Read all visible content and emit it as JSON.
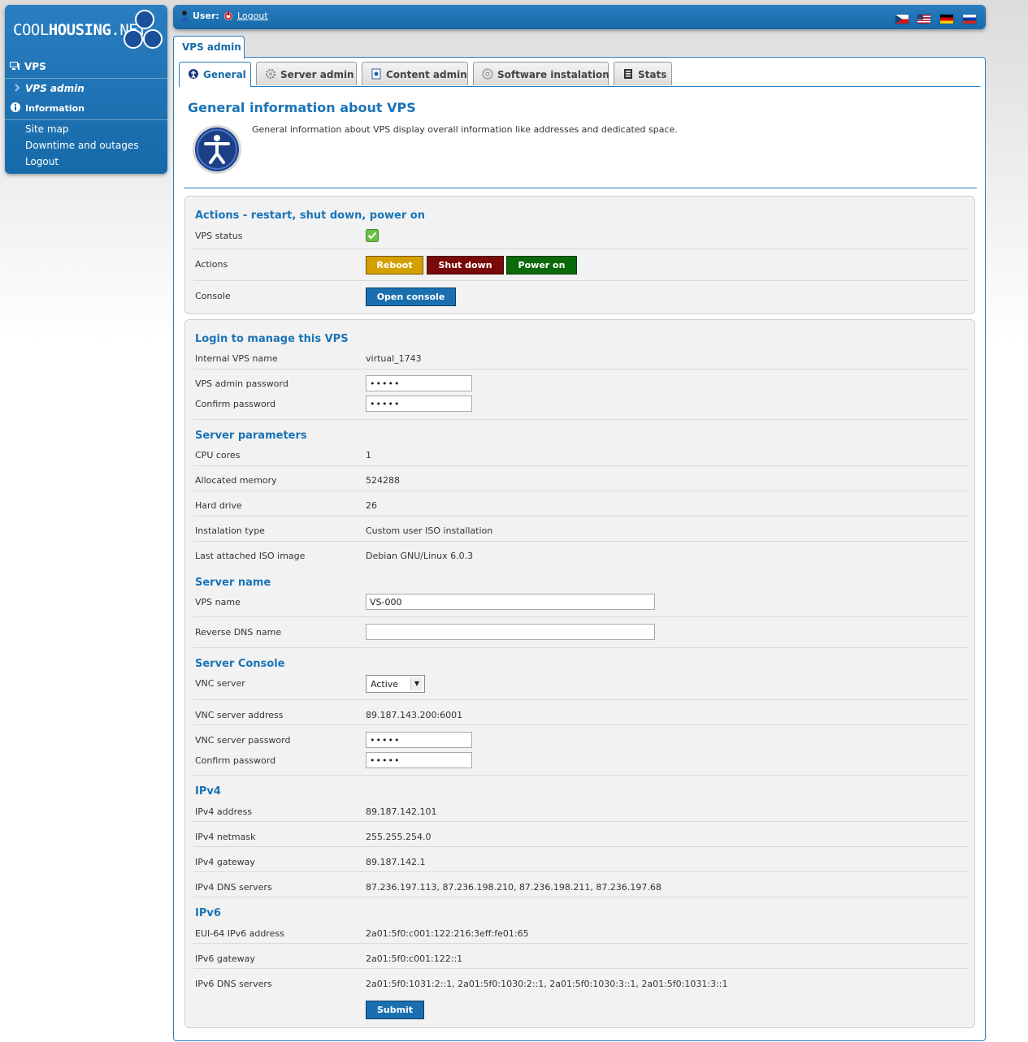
{
  "brand": {
    "name_light": "COOL",
    "name_bold": "HOUSING",
    "name_suffix": ".NET"
  },
  "sidebar": {
    "sections": [
      {
        "label": "VPS",
        "icon": "monitor-icon"
      },
      {
        "label": "VPS admin",
        "icon": "chevron-right-icon",
        "active": true
      },
      {
        "label": "Information",
        "icon": "info-icon"
      }
    ],
    "links": [
      "Site map",
      "Downtime and outages",
      "Logout"
    ]
  },
  "topbar": {
    "user_label": "User:",
    "logout_label": "Logout",
    "languages": [
      "Czech",
      "English",
      "German",
      "Russian"
    ]
  },
  "outer_tab": "VPS admin",
  "tabs": [
    {
      "label": "General",
      "icon": "info-icon",
      "active": true
    },
    {
      "label": "Server admin",
      "icon": "gear-icon"
    },
    {
      "label": "Content admin",
      "icon": "document-icon"
    },
    {
      "label": "Software instalation",
      "icon": "disc-icon"
    },
    {
      "label": "Stats",
      "icon": "stats-icon"
    }
  ],
  "page": {
    "title": "General information about VPS",
    "description": "General information about VPS display overall information like addresses and dedicated space."
  },
  "actions": {
    "heading": "Actions - restart, shut down, power on",
    "status_label": "VPS status",
    "actions_label": "Actions",
    "console_label": "Console",
    "reboot": "Reboot",
    "shutdown": "Shut down",
    "poweron": "Power on",
    "open_console": "Open console"
  },
  "login": {
    "heading": "Login to manage this VPS",
    "internal_name_label": "Internal VPS name",
    "internal_name": "virtual_1743",
    "password_label": "VPS admin password",
    "password_value": "•••••",
    "confirm_label": "Confirm password",
    "confirm_value": "•••••"
  },
  "params": {
    "heading": "Server parameters",
    "rows": [
      {
        "label": "CPU cores",
        "value": "1"
      },
      {
        "label": "Allocated memory",
        "value": "524288"
      },
      {
        "label": "Hard drive",
        "value": "26"
      },
      {
        "label": "Instalation type",
        "value": "Custom user ISO installation"
      },
      {
        "label": "Last attached ISO image",
        "value": "Debian GNU/Linux 6.0.3"
      }
    ]
  },
  "server_name": {
    "heading": "Server name",
    "vps_name_label": "VPS name",
    "vps_name_value": "VS-000",
    "rdns_label": "Reverse DNS name",
    "rdns_value": ""
  },
  "console": {
    "heading": "Server Console",
    "vnc_label": "VNC server",
    "vnc_value": "Active",
    "vnc_address_label": "VNC server address",
    "vnc_address": "89.187.143.200:6001",
    "vnc_password_label": "VNC server password",
    "vnc_password_value": "•••••",
    "confirm_label": "Confirm password",
    "confirm_value": "•••••"
  },
  "ipv4": {
    "heading": "IPv4",
    "rows": [
      {
        "label": "IPv4 address",
        "value": "89.187.142.101"
      },
      {
        "label": "IPv4 netmask",
        "value": "255.255.254.0"
      },
      {
        "label": "IPv4 gateway",
        "value": "89.187.142.1"
      },
      {
        "label": "IPv4 DNS servers",
        "value": "87.236.197.113, 87.236.198.210, 87.236.198.211, 87.236.197.68"
      }
    ]
  },
  "ipv6": {
    "heading": "IPv6",
    "rows": [
      {
        "label": "EUI-64 IPv6 address",
        "value": "2a01:5f0:c001:122:216:3eff:fe01:65"
      },
      {
        "label": "IPv6 gateway",
        "value": "2a01:5f0:c001:122::1"
      },
      {
        "label": "IPv6 DNS servers",
        "value": "2a01:5f0:1031:2::1, 2a01:5f0:1030:2::1, 2a01:5f0:1030:3::1, 2a01:5f0:1031:3::1"
      }
    ]
  },
  "submit_label": "Submit",
  "colors": {
    "brand_blue": "#166aa9",
    "heading_blue": "#1a74b8",
    "reboot": "#d4a000",
    "shutdown": "#7a0a0a",
    "poweron": "#0a6a0a",
    "primary": "#1a6fb0"
  }
}
